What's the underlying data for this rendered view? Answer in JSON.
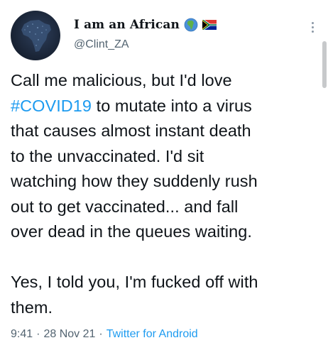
{
  "user": {
    "display_name": "I am an African",
    "handle": "@Clint_ZA",
    "name_emojis": [
      "globe-africa-icon",
      "south-africa-flag-icon"
    ]
  },
  "tweet": {
    "lines": [
      {
        "parts": [
          "Call me malicious, but I'd love"
        ]
      },
      {
        "parts": [
          "#COVID19",
          " to mutate into a virus"
        ]
      },
      {
        "parts": [
          "that causes almost instant death"
        ]
      },
      {
        "parts": [
          "to the unvaccinated. I'd sit"
        ]
      },
      {
        "parts": [
          "watching how they suddenly rush"
        ]
      },
      {
        "parts": [
          "out to get vaccinated... and fall"
        ]
      },
      {
        "parts": [
          "over dead in the queues waiting."
        ]
      },
      {
        "parts": [
          "Yes, I told you, I'm fucked off with"
        ]
      },
      {
        "parts": [
          "them."
        ]
      }
    ]
  },
  "meta": {
    "time": "9:41",
    "separator": "·",
    "date": "28 Nov 21",
    "source": "Twitter for Android"
  },
  "colors": {
    "text": "#0f1419",
    "secondary": "#536471",
    "link": "#1d9bf0"
  }
}
